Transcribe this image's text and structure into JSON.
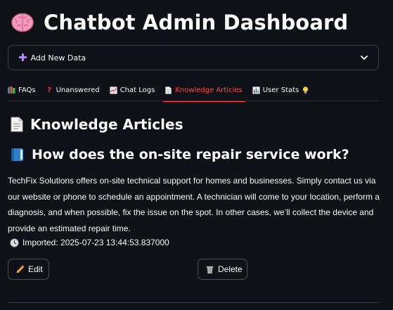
{
  "app": {
    "title": "Chatbot Admin Dashboard",
    "title_icon": "brain-icon"
  },
  "expander": {
    "label": "Add New Data",
    "icon": "plus-icon",
    "state": "collapsed"
  },
  "tabs": [
    {
      "label": "FAQs",
      "icon": "books-icon",
      "active": false
    },
    {
      "label": "Unanswered",
      "icon": "question-mark-icon",
      "active": false
    },
    {
      "label": "Chat Logs",
      "icon": "chart-icon",
      "active": false
    },
    {
      "label": "Knowledge Articles",
      "icon": "page-icon",
      "active": true
    },
    {
      "label": "User Stats",
      "icon": "bar-chart-icon",
      "trailing_icon": "lightbulb-icon",
      "active": false
    }
  ],
  "section": {
    "heading": "Knowledge Articles",
    "icon": "page-icon"
  },
  "article": {
    "title": "How does the on-site repair service work?",
    "icon": "blue-book-icon",
    "body": "TechFix Solutions offers on-site technical support for homes and businesses. Simply contact us via our website or phone to schedule an appointment. A technician will come to your location, perform a diagnosis, and when possible, fix the issue on the spot. In other cases, we’ll collect the device and provide an estimated repair time.",
    "imported_label": "Imported: 2025-07-23 13:44:53.837000",
    "imported_icon": "clock-icon"
  },
  "actions": {
    "edit_label": "Edit",
    "edit_icon": "pencil-icon",
    "delete_label": "Delete",
    "delete_icon": "wastebasket-icon"
  },
  "colors": {
    "background": "#0e1117",
    "text": "#fafafa",
    "accent_active_tab": "#ff4b4b",
    "border": "#3a3d45"
  }
}
